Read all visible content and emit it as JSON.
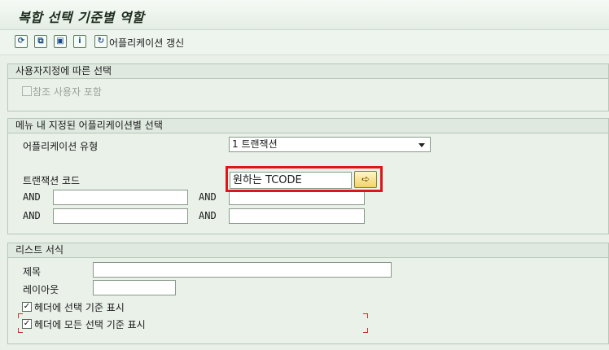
{
  "window": {
    "title": "복합 선택 기준별 역할"
  },
  "toolbar": {
    "items": [
      {
        "icon": "execute-icon",
        "glyph": "⟳"
      },
      {
        "icon": "copy-icon",
        "glyph": "⧉"
      },
      {
        "icon": "save-variant-icon",
        "glyph": "▣"
      },
      {
        "icon": "info-icon",
        "glyph": "i"
      },
      {
        "icon": "refresh-icon",
        "glyph": "↻"
      }
    ],
    "refresh_label": "어플리케이션 갱신"
  },
  "groups": {
    "user_assignment": {
      "header": "사용자지정에 따른 선택",
      "include_ref_user_label": "참조 사용자 포함",
      "include_ref_user_checked": false
    },
    "menu_app": {
      "header": "메뉴 내 지정된 어플리케이션별 선택",
      "app_type_label": "어플리케이션 유형",
      "app_type_value": "1 트랜잭션",
      "tcode_label": "트랜잭션 코드",
      "tcode_value": "원하는 TCODE",
      "and_label": "AND"
    },
    "list_format": {
      "header": "리스트 서식",
      "title_label": "제목",
      "layout_label": "레이아웃",
      "show_header_criteria_label": "헤더에 선택 기준 표시",
      "show_header_criteria_checked": true,
      "show_all_header_criteria_label": "헤더에 모든 선택 기준 표시",
      "show_all_header_criteria_checked": true
    }
  },
  "colors": {
    "highlight": "#e0151b",
    "background": "#e8f0e8"
  }
}
